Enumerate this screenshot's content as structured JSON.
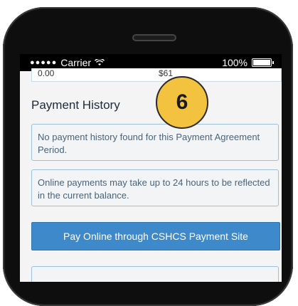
{
  "status_bar": {
    "signal_dots": "●●●●●",
    "carrier": "Carrier",
    "battery_percent": "100%"
  },
  "previous_row": {
    "left_value": "0.00",
    "right_value": "$61"
  },
  "section": {
    "title": "Payment History"
  },
  "messages": {
    "no_history": "No payment history found for this Payment Agreement Period.",
    "online_delay": "Online payments may take up to 24 hours to be reflected in the current balance."
  },
  "actions": {
    "pay_online_label": "Pay Online through CSHCS Payment Site"
  },
  "callout": {
    "number": "6"
  },
  "colors": {
    "button": "#3d89c9",
    "info_border": "#9dc0dc",
    "badge": "#f3c33f"
  }
}
